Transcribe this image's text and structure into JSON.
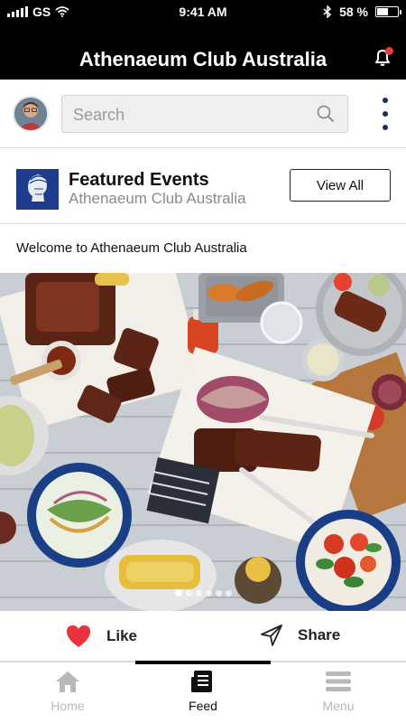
{
  "status_bar": {
    "carrier": "GS",
    "time": "9:41 AM",
    "battery": "58 %",
    "battery_level": 0.58
  },
  "header": {
    "title": "Athenaeum Club Australia",
    "notification_icon": "bell-icon"
  },
  "search": {
    "placeholder": "Search"
  },
  "featured": {
    "title": "Featured Events",
    "subtitle": "Athenaeum Club Australia",
    "view_all_label": "View All"
  },
  "post": {
    "text": "Welcome to Athenaeum Club Australia",
    "carousel_count": 6,
    "carousel_active": 1
  },
  "actions": {
    "like_label": "Like",
    "share_label": "Share"
  },
  "bottom_nav": {
    "items": [
      {
        "label": "Home",
        "icon": "home-icon",
        "active": false
      },
      {
        "label": "Feed",
        "icon": "feed-icon",
        "active": true
      },
      {
        "label": "Menu",
        "icon": "menu-icon",
        "active": false
      }
    ]
  },
  "colors": {
    "header_bg": "#000000",
    "like_heart": "#e8323c",
    "kebab": "#1d2f52",
    "logo_bg": "#1f3c8c"
  }
}
